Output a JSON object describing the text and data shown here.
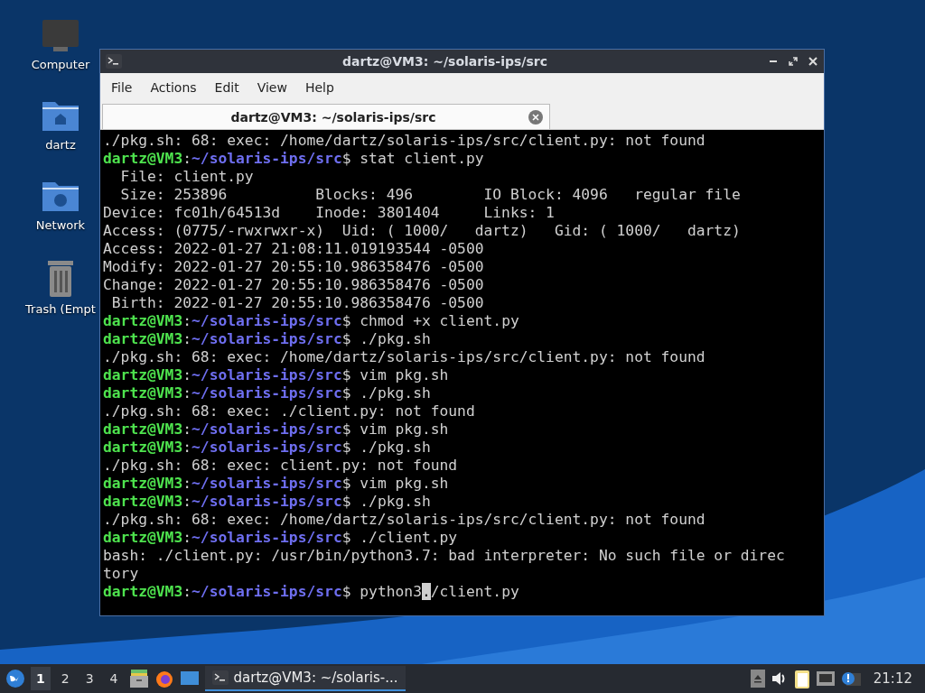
{
  "desktop_icons": [
    {
      "kind": "monitor",
      "label": "Computer"
    },
    {
      "kind": "home",
      "label": "dartz"
    },
    {
      "kind": "network",
      "label": "Network"
    },
    {
      "kind": "trash",
      "label": "Trash (Empt"
    }
  ],
  "window": {
    "title": "dartz@VM3: ~/solaris-ips/src",
    "menu": [
      "File",
      "Actions",
      "Edit",
      "View",
      "Help"
    ],
    "tabs": [
      {
        "label": "dartz@VM3: ~/solaris-ips/src",
        "selected": true
      }
    ],
    "terminal": [
      {
        "kind": "output",
        "text": "./pkg.sh: 68: exec: /home/dartz/solaris-ips/src/client.py: not found"
      },
      {
        "kind": "prompt",
        "user": "dartz@VM3",
        "path": "~/solaris-ips/src",
        "command": "stat client.py",
        "sep": ":",
        "sigil": "$"
      },
      {
        "kind": "output",
        "text": "  File: client.py"
      },
      {
        "kind": "output",
        "text": "  Size: 253896          Blocks: 496        IO Block: 4096   regular file"
      },
      {
        "kind": "output",
        "text": "Device: fc01h/64513d    Inode: 3801404     Links: 1"
      },
      {
        "kind": "output",
        "text": "Access: (0775/-rwxrwxr-x)  Uid: ( 1000/   dartz)   Gid: ( 1000/   dartz)"
      },
      {
        "kind": "output",
        "text": "Access: 2022-01-27 21:08:11.019193544 -0500"
      },
      {
        "kind": "output",
        "text": "Modify: 2022-01-27 20:55:10.986358476 -0500"
      },
      {
        "kind": "output",
        "text": "Change: 2022-01-27 20:55:10.986358476 -0500"
      },
      {
        "kind": "output",
        "text": " Birth: 2022-01-27 20:55:10.986358476 -0500"
      },
      {
        "kind": "prompt",
        "user": "dartz@VM3",
        "path": "~/solaris-ips/src",
        "command": "chmod +x client.py",
        "sep": ":",
        "sigil": "$"
      },
      {
        "kind": "prompt",
        "user": "dartz@VM3",
        "path": "~/solaris-ips/src",
        "command": "./pkg.sh",
        "sep": ":",
        "sigil": "$"
      },
      {
        "kind": "output",
        "text": "./pkg.sh: 68: exec: /home/dartz/solaris-ips/src/client.py: not found"
      },
      {
        "kind": "prompt",
        "user": "dartz@VM3",
        "path": "~/solaris-ips/src",
        "command": "vim pkg.sh",
        "sep": ":",
        "sigil": "$"
      },
      {
        "kind": "prompt",
        "user": "dartz@VM3",
        "path": "~/solaris-ips/src",
        "command": "./pkg.sh",
        "sep": ":",
        "sigil": "$"
      },
      {
        "kind": "output",
        "text": "./pkg.sh: 68: exec: ./client.py: not found"
      },
      {
        "kind": "prompt",
        "user": "dartz@VM3",
        "path": "~/solaris-ips/src",
        "command": "vim pkg.sh",
        "sep": ":",
        "sigil": "$"
      },
      {
        "kind": "prompt",
        "user": "dartz@VM3",
        "path": "~/solaris-ips/src",
        "command": "./pkg.sh",
        "sep": ":",
        "sigil": "$"
      },
      {
        "kind": "output",
        "text": "./pkg.sh: 68: exec: client.py: not found"
      },
      {
        "kind": "prompt",
        "user": "dartz@VM3",
        "path": "~/solaris-ips/src",
        "command": "vim pkg.sh",
        "sep": ":",
        "sigil": "$"
      },
      {
        "kind": "prompt",
        "user": "dartz@VM3",
        "path": "~/solaris-ips/src",
        "command": "./pkg.sh",
        "sep": ":",
        "sigil": "$"
      },
      {
        "kind": "output",
        "text": "./pkg.sh: 68: exec: /home/dartz/solaris-ips/src/client.py: not found"
      },
      {
        "kind": "prompt",
        "user": "dartz@VM3",
        "path": "~/solaris-ips/src",
        "command": "./client.py",
        "sep": ":",
        "sigil": "$"
      },
      {
        "kind": "output",
        "text": "bash: ./client.py: /usr/bin/python3.7: bad interpreter: No such file or direc"
      },
      {
        "kind": "output",
        "text": "tory"
      },
      {
        "kind": "prompt",
        "user": "dartz@VM3",
        "path": "~/solaris-ips/src",
        "command": "python3",
        "sep": ":",
        "sigil": "$",
        "cursor": ".",
        "after": "/client.py"
      }
    ]
  },
  "taskbar": {
    "workspaces": [
      {
        "label": "1",
        "selected": true
      },
      {
        "label": "2",
        "selected": false
      },
      {
        "label": "3",
        "selected": false
      },
      {
        "label": "4",
        "selected": false
      }
    ],
    "task": {
      "label": "dartz@VM3: ~/solaris-...",
      "selected": true
    },
    "clock": "21:12"
  }
}
